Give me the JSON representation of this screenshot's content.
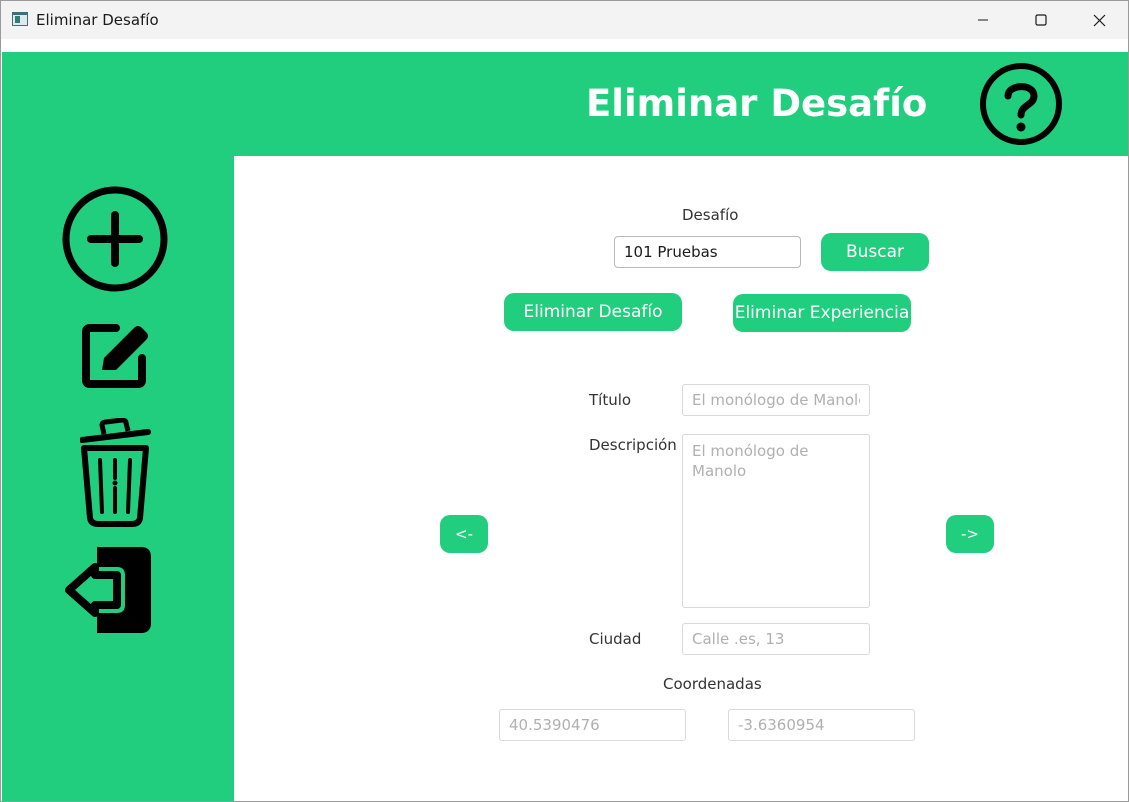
{
  "window": {
    "title": "Eliminar Desafío"
  },
  "header": {
    "title": "Eliminar Desafío",
    "help_icon": "question-circle-icon"
  },
  "sidebar": {
    "items": [
      {
        "name": "add",
        "icon": "plus-circle-icon"
      },
      {
        "name": "edit",
        "icon": "edit-square-icon"
      },
      {
        "name": "delete",
        "icon": "trash-icon"
      },
      {
        "name": "logout",
        "icon": "logout-icon"
      }
    ]
  },
  "form": {
    "desafio_label": "Desafío",
    "desafio_value": "101 Pruebas",
    "buscar_label": "Buscar",
    "eliminar_desafio_label": "Eliminar Desafío",
    "eliminar_experiencia_label": "Eliminar Experiencia",
    "prev_label": "<-",
    "next_label": "->",
    "titulo_label": "Título",
    "titulo_placeholder": "El monólogo de Manolo",
    "descripcion_label": "Descripción",
    "descripcion_placeholder": "El monólogo de Manolo",
    "ciudad_label": "Ciudad",
    "ciudad_placeholder": "Calle .es, 13",
    "coordenadas_label": "Coordenadas",
    "latitud_placeholder": "40.5390476",
    "longitud_placeholder": "-3.6360954"
  },
  "colors": {
    "accent": "#21ce7e",
    "background": "#ffffff",
    "icon": "#000000"
  }
}
